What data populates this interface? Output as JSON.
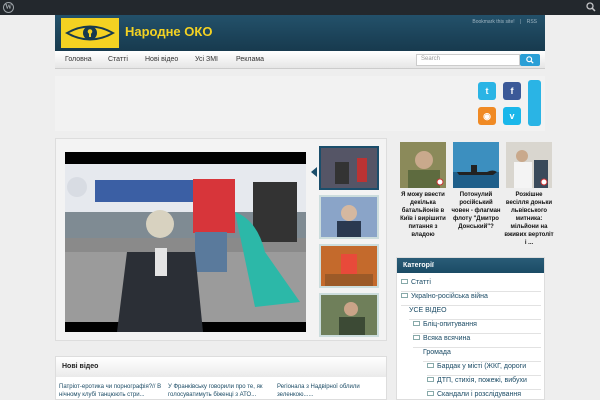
{
  "site": {
    "logo_text": "Народне ОКО",
    "logo_icon": "eye-keyhole-icon",
    "wp_icon": "wordpress-icon",
    "search_icon": "search-icon"
  },
  "top_links": {
    "bookmark": "Bookmark this site!",
    "rss": "RSS"
  },
  "nav": {
    "items": [
      "Головна",
      "Статті",
      "Нові відео",
      "Усі ЗМІ",
      "Реклама"
    ],
    "search_placeholder": "Search"
  },
  "social": [
    {
      "name": "twitter-icon",
      "glyph": "t",
      "color": "#2ab4e5"
    },
    {
      "name": "facebook-icon",
      "glyph": "f",
      "color": "#3b5998"
    },
    {
      "name": "rss-icon",
      "glyph": "◉",
      "color": "#f08a24"
    },
    {
      "name": "vimeo-icon",
      "glyph": "v",
      "color": "#1ab7ea"
    }
  ],
  "feature_news": [
    {
      "caption": "Я можу ввести декілька батальйонів в Київ і вирішити питання з владою"
    },
    {
      "caption": "Потонулий російський човен - флагман флоту \"Дмитро Донський\"?"
    },
    {
      "caption": "Розкішне весілля доньки львівського митника: мільйони на вживих вертоліт і ..."
    }
  ],
  "categories": {
    "title": "Категорії",
    "items": [
      "Статті",
      "Україно-російська війна",
      "УСЕ ВІДЕО",
      "Бліц-опитування",
      "Всяка всячина",
      "Громада",
      "Бардак у місті (ЖКГ, дороги",
      "ДТП, стихія, пожежі, вибухи",
      "Скандали і розслідування"
    ]
  },
  "new_videos": {
    "title": "Нові відео",
    "links": [
      "Патріот-еротика чи порнографія?// В нічному клубі танцюють стри...",
      "У Франківську говорили про те, як голосуватимуть біженці з АТО...",
      "Регіонала з Надвірної облили зеленкою......"
    ]
  }
}
